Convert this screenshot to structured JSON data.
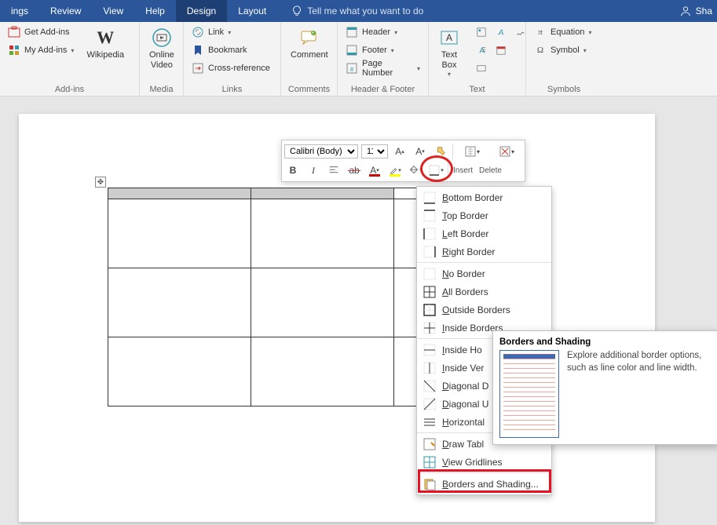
{
  "tabs": {
    "items": [
      "ings",
      "Review",
      "View",
      "Help",
      "Design",
      "Layout"
    ],
    "active_index": 4,
    "tellme": "Tell me what you want to do",
    "user": "Sha"
  },
  "ribbon": {
    "addins": {
      "label": "Add-ins",
      "get": "Get Add-ins",
      "my": "My Add-ins",
      "wiki": "Wikipedia"
    },
    "media": {
      "label": "Media",
      "video": "Online\nVideo"
    },
    "links": {
      "label": "Links",
      "link": "Link",
      "bookmark": "Bookmark",
      "xref": "Cross-reference"
    },
    "comments": {
      "label": "Comments",
      "comment": "Comment"
    },
    "hf": {
      "label": "Header & Footer",
      "header": "Header",
      "footer": "Footer",
      "pagenum": "Page Number"
    },
    "text": {
      "label": "Text",
      "textbox": "Text\nBox"
    },
    "symbols": {
      "label": "Symbols",
      "equation": "Equation",
      "symbol": "Symbol"
    }
  },
  "minitoolbar": {
    "font": "Calibri (Body)",
    "size": "11",
    "insert": "Insert",
    "delete": "Delete"
  },
  "menu": {
    "items": [
      {
        "icon": "border-bottom",
        "first": "B",
        "text": "ottom Border"
      },
      {
        "icon": "border-top",
        "first": "T",
        "text": "op Border"
      },
      {
        "icon": "border-left",
        "first": "L",
        "text": "eft Border"
      },
      {
        "icon": "border-right",
        "first": "R",
        "text": "ight Border"
      },
      {
        "sep": true
      },
      {
        "icon": "border-none",
        "first": "N",
        "text": "o Border"
      },
      {
        "icon": "border-all",
        "first": "A",
        "text": "ll Borders"
      },
      {
        "icon": "border-outside",
        "first": "O",
        "text": "utside Borders"
      },
      {
        "icon": "border-inside",
        "first": "I",
        "text": "nside Borders"
      },
      {
        "sep": true
      },
      {
        "icon": "border-ih",
        "first": "I",
        "text": "nside Ho"
      },
      {
        "icon": "border-iv",
        "first": "I",
        "text": "nside Ver"
      },
      {
        "icon": "border-diag-d",
        "first": "D",
        "text": "iagonal D"
      },
      {
        "icon": "border-diag-u",
        "first": "D",
        "text": "iagonal U"
      },
      {
        "icon": "border-hz",
        "first": "H",
        "text": "orizontal"
      },
      {
        "sep": true
      },
      {
        "icon": "draw-table",
        "first": "D",
        "text": "raw Tabl"
      },
      {
        "icon": "gridlines",
        "first": "V",
        "text": "iew Gridlines"
      },
      {
        "sep": true
      },
      {
        "icon": "borders-shading",
        "first": "B",
        "text": "orders and Shading...",
        "hl": true
      }
    ]
  },
  "tooltip": {
    "title": "Borders and Shading",
    "text": "Explore additional border options, such as line color and line width."
  }
}
